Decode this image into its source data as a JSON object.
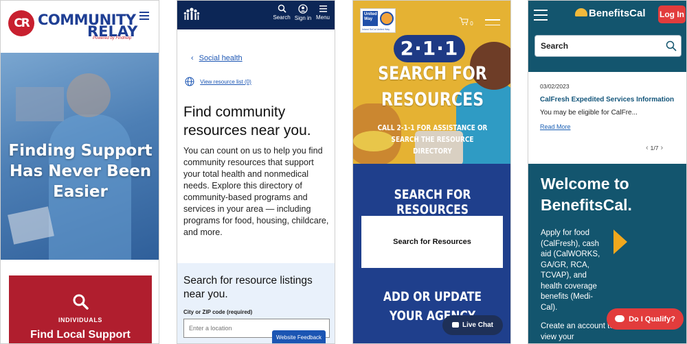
{
  "panel1": {
    "logo_initials": "CR",
    "logo_line1": "COMMUNITY",
    "logo_line2": "RELAY",
    "logo_tagline": "Powered by Findhelp",
    "hero_title": "Finding Support Has Never Been Easier",
    "card_kicker": "INDIVIDUALS",
    "card_title": "Find Local Support",
    "colors": {
      "brand_blue": "#1f3f94",
      "brand_red": "#b01e2e"
    }
  },
  "panel2": {
    "nav": {
      "search": "Search",
      "signin": "Sign in",
      "menu": "Menu"
    },
    "back_link": "Social health",
    "view_list": "View resource list (0)",
    "heading": "Find community resources near you.",
    "intro": "You can count on us to help you find community resources that support your total health and nonmedical needs. Explore this directory of community-based programs and services in your area — including programs for food, housing, childcare, and more.",
    "search_heading": "Search for resource listings near you.",
    "field_label": "City or ZIP code (required)",
    "field_placeholder": "Enter a location",
    "feedback_button": "Website Feedback",
    "colors": {
      "header": "#0c2656",
      "link": "#1b55b3"
    }
  },
  "panel3": {
    "logo_text": "United Way",
    "logo_sub": "Inland SoCal United Way",
    "cart_count": "0",
    "badge": "2·1·1",
    "hero_title": "SEARCH FOR RESOURCES",
    "hero_sub": "CALL 2-1-1 FOR ASSISTANCE OR SEARCH THE RESOURCE DIRECTORY",
    "section_title": "SEARCH FOR RESOURCES",
    "search_button": "Search for Resources",
    "section2_title": "ADD OR UPDATE YOUR AGENCY",
    "chat_button": "Live Chat",
    "colors": {
      "hero": "#e5b233",
      "page": "#1f3f8c"
    }
  },
  "panel4": {
    "brand": "BenefitsCal",
    "login_button": "Log In",
    "search_placeholder": "Search",
    "news": {
      "date": "03/02/2023",
      "title": "CalFresh Expedited Services Information",
      "body": "You may be eligible for CalFre...",
      "link": "Read More"
    },
    "pager": "1/7",
    "welcome_title": "Welcome to BenefitsCal.",
    "welcome_text": "Apply for food (CalFresh), cash aid (CalWORKS, GA/GR, RCA, TCVAP), and health coverage benefits (Medi-Cal).",
    "welcome_text2": "Create an account to view your",
    "qualify_button": "Do I Qualify?",
    "colors": {
      "teal": "#13556e",
      "red": "#e23c3c",
      "gold": "#f2a81d"
    }
  }
}
